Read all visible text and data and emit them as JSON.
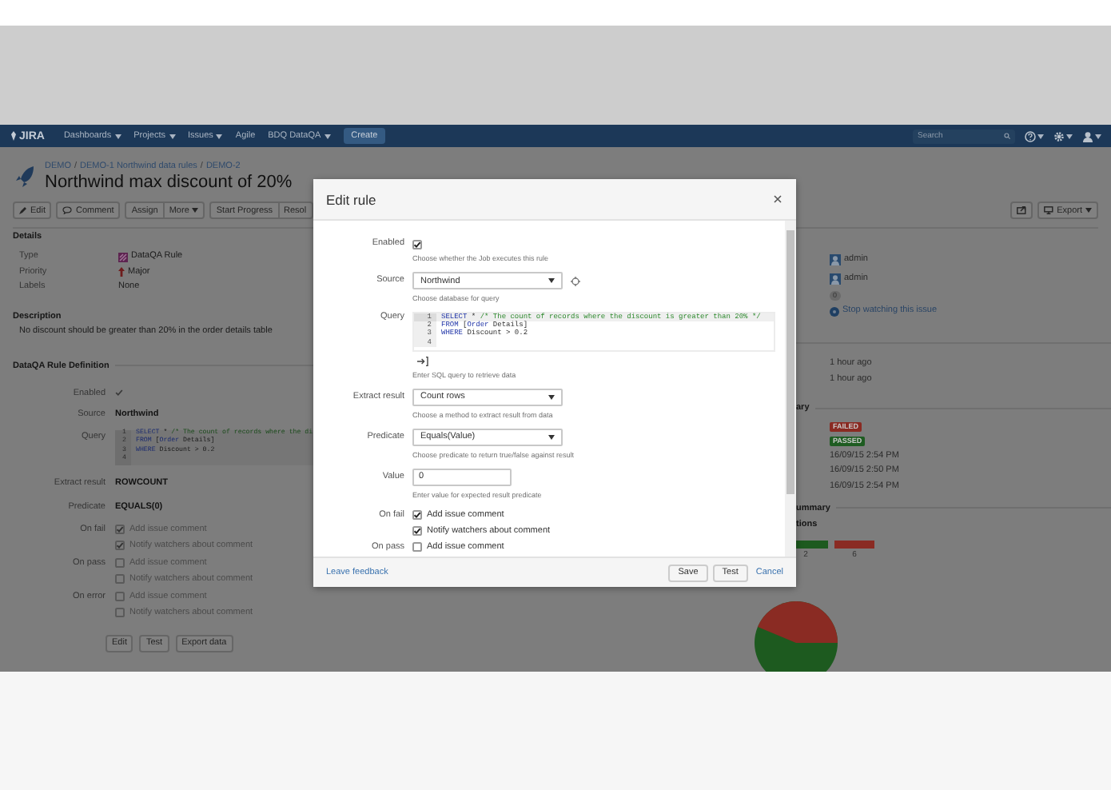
{
  "nav": {
    "logo": "JIRA",
    "menus": [
      {
        "label": "Dashboards",
        "dropdown": true
      },
      {
        "label": "Projects",
        "dropdown": true
      },
      {
        "label": "Issues",
        "dropdown": true
      },
      {
        "label": "Agile",
        "dropdown": false
      },
      {
        "label": "BDQ DataQA",
        "dropdown": true
      }
    ],
    "create": "Create",
    "search": {
      "placeholder": "Search"
    }
  },
  "issue": {
    "breadcrumbs": [
      "DEMO",
      "DEMO-1 Northwind data rules",
      "DEMO-2"
    ],
    "breadcrumb_separator": "/",
    "title": "Northwind max discount of 20%"
  },
  "toolbar": {
    "groups": [
      [
        {
          "label": "Edit",
          "dropdown": false
        }
      ],
      [
        {
          "label": "Comment",
          "dropdown": false
        }
      ],
      [
        {
          "label": "Assign",
          "dropdown": false
        },
        {
          "label": "More",
          "dropdown": true
        }
      ],
      [
        {
          "label": "Start Progress",
          "dropdown": false
        },
        {
          "label": "Resol",
          "dropdown": false
        }
      ]
    ],
    "export": {
      "label": "Export",
      "dropdown": true
    }
  },
  "details": {
    "heading": "Details",
    "fields": [
      {
        "label": "Type",
        "value": "DataQA Rule"
      },
      {
        "label": "Priority",
        "value": "Major"
      },
      {
        "label": "Labels",
        "value": "None"
      }
    ]
  },
  "people": [
    "admin",
    "admin"
  ],
  "votes": "0",
  "watch": "Stop watching this issue",
  "description": {
    "heading": "Description",
    "text": "No discount should be greater than 20% in the order details table"
  },
  "dates": [
    "1 hour ago",
    "1 hour ago"
  ],
  "rule": {
    "heading": "DataQA Rule Definition",
    "enabled": {
      "label": "Enabled",
      "checked": true
    },
    "source": {
      "label": "Source",
      "value": "Northwind"
    },
    "query": {
      "label": "Query",
      "lines": [
        {
          "number": "1",
          "tokens": [
            {
              "kind": "keyword",
              "text": "SELECT"
            },
            {
              "kind": "plain",
              "text": " * "
            },
            {
              "kind": "comment",
              "text": "/* The count of records where the di"
            }
          ]
        },
        {
          "number": "2",
          "tokens": [
            {
              "kind": "keyword",
              "text": "FROM"
            },
            {
              "kind": "plain",
              "text": " ["
            },
            {
              "kind": "keyword",
              "text": "Order"
            },
            {
              "kind": "plain",
              "text": " Details]"
            }
          ]
        },
        {
          "number": "3",
          "tokens": [
            {
              "kind": "keyword",
              "text": "WHERE"
            },
            {
              "kind": "plain",
              "text": " Discount > 0.2"
            }
          ]
        },
        {
          "number": "4"
        }
      ]
    },
    "extract": {
      "label": "Extract result",
      "value": "ROWCOUNT"
    },
    "predicate": {
      "label": "Predicate",
      "value": "EQUALS(0)"
    },
    "actions": [
      {
        "label": "On fail",
        "options": [
          {
            "label": "Add issue comment",
            "checked": true
          },
          {
            "label": "Notify watchers about comment",
            "checked": true
          }
        ]
      },
      {
        "label": "On pass",
        "options": [
          {
            "label": "Add issue comment",
            "checked": false
          },
          {
            "label": "Notify watchers about comment",
            "checked": false
          }
        ]
      },
      {
        "label": "On error",
        "options": [
          {
            "label": "Add issue comment",
            "checked": false
          },
          {
            "label": "Notify watchers about comment",
            "checked": false
          }
        ]
      }
    ],
    "buttons": [
      "Edit",
      "Test",
      "Export data"
    ]
  },
  "summary": {
    "heading": "ary",
    "results": [
      {
        "label": "FAILED",
        "color": "#8a2a22"
      },
      {
        "label": "PASSED",
        "color": "#1e5c21"
      }
    ],
    "dates": [
      "16/09/15 2:54 PM",
      "16/09/15 2:50 PM",
      "16/09/15 2:54 PM"
    ]
  },
  "executions": {
    "heading": "ummary",
    "subheading": "tions",
    "bars": [
      {
        "count": "2",
        "color": "#1d5a1f"
      },
      {
        "count": "6",
        "color": "#8a2b23"
      }
    ]
  },
  "modal": {
    "title": "Edit rule",
    "fields": [
      {
        "kind": "checkbox",
        "label": "Enabled",
        "checked": true,
        "help": "Choose whether the Job executes this rule"
      },
      {
        "kind": "select",
        "label": "Source",
        "value": "Northwind",
        "refresh": true,
        "help": "Choose database for query"
      },
      {
        "kind": "code",
        "label": "Query",
        "lines": [
          {
            "number": "1",
            "active": true,
            "tokens": [
              {
                "kind": "keyword",
                "text": "SELECT"
              },
              {
                "kind": "plain",
                "text": " * "
              },
              {
                "kind": "comment",
                "text": "/* The count of records where the discount is greater than 20% */"
              }
            ]
          },
          {
            "number": "2",
            "active": false,
            "tokens": [
              {
                "kind": "keyword",
                "text": "FROM"
              },
              {
                "kind": "plain",
                "text": " ["
              },
              {
                "kind": "keyword",
                "text": "Order"
              },
              {
                "kind": "plain",
                "text": " Details]"
              }
            ]
          },
          {
            "number": "3",
            "active": false,
            "tokens": [
              {
                "kind": "keyword",
                "text": "WHERE"
              },
              {
                "kind": "plain",
                "text": " Discount > 0.2"
              }
            ]
          },
          {
            "number": "4",
            "active": false
          }
        ],
        "help": "Enter SQL query to retrieve data"
      },
      {
        "kind": "select",
        "label": "Extract result",
        "value": "Count rows",
        "help": "Choose a method to extract result from data"
      },
      {
        "kind": "select",
        "label": "Predicate",
        "value": "Equals(Value)",
        "help": "Choose predicate to return true/false against result"
      },
      {
        "kind": "input",
        "label": "Value",
        "value": "0",
        "help": "Enter value for expected result predicate"
      },
      {
        "kind": "checks",
        "label": "On fail",
        "options": [
          {
            "label": "Add issue comment",
            "checked": true
          },
          {
            "label": "Notify watchers about comment",
            "checked": true
          }
        ]
      },
      {
        "kind": "checks",
        "label": "On pass",
        "options": [
          {
            "label": "Add issue comment",
            "checked": false
          }
        ]
      }
    ],
    "feedback": "Leave feedback",
    "buttons": [
      "Save",
      "Test"
    ],
    "cancel": "Cancel"
  }
}
